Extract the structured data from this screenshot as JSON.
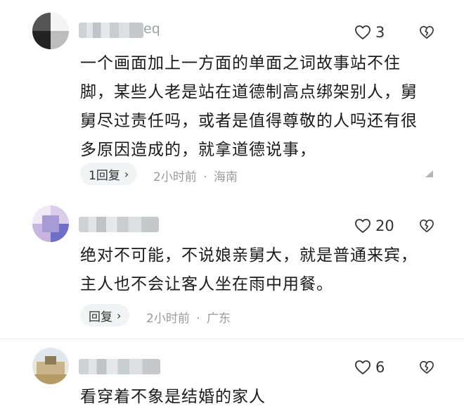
{
  "comments": [
    {
      "name_tail": "eq",
      "like_count": "3",
      "body": "一个画面加上一方面的单面之词故事站不住脚，某些人老是站在道德制高点绑架别人，舅舅尽过责任吗，或者是值得尊敬的人吗还有很多原因造成的，就拿道德说事，",
      "body_lines": [
        "一个画面加上一方面的单面之词故事站不住",
        "脚，某些人老是站在道德制高点绑架别人，舅",
        "舅尽过责任吗，或者是值得尊敬的人吗还有很",
        "多原因造成的，就拿道德说事，"
      ],
      "reply_label": "1回复",
      "time": "2小时前",
      "sep": "·",
      "location": "海南"
    },
    {
      "name_tail": "",
      "like_count": "20",
      "body_lines": [
        "绝对不可能，不说娘亲舅大，就是普通来宾，",
        "主人也不会让客人坐在雨中用餐。"
      ],
      "reply_label": "回复",
      "time": "2小时前",
      "sep": "·",
      "location": "广东"
    },
    {
      "name_tail": "",
      "like_count": "6",
      "body_lines": [
        "看穿着不象是结婚的家人"
      ]
    }
  ],
  "icons": {
    "like": "heart-outline-icon",
    "dislike": "broken-heart-icon",
    "reply_chevron": "chevron-right-icon",
    "more": "triangle-more-icon"
  },
  "colors": {
    "text": "#1a1a1a",
    "meta": "#9a9a9a",
    "reply_bg": "#f2f3f5"
  }
}
